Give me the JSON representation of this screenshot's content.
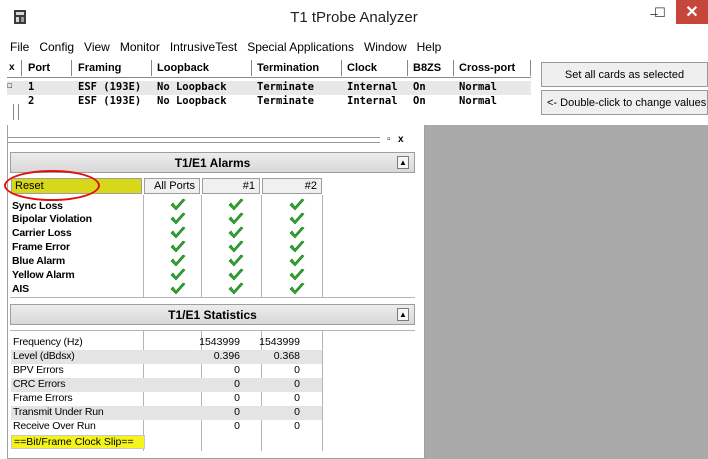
{
  "window": {
    "title": "T1 tProbe Analyzer",
    "icon": "app-icon",
    "controls": {
      "minimize": "–",
      "maximize": "☐",
      "close": "✕"
    }
  },
  "menu": [
    "File",
    "Config",
    "View",
    "Monitor",
    "IntrusiveTest",
    "Special Applications",
    "Window",
    "Help"
  ],
  "port_table": {
    "close_glyph": "x",
    "columns": [
      "Port",
      "Framing",
      "Loopback",
      "Termination",
      "Clock",
      "B8ZS",
      "Cross-port"
    ],
    "rows": [
      {
        "port": "1",
        "framing": "ESF (193E)",
        "loopback": "No Loopback",
        "termination": "Terminate",
        "clock": "Internal",
        "b8zs": "On",
        "cross_port": "Normal"
      },
      {
        "port": "2",
        "framing": "ESF (193E)",
        "loopback": "No Loopback",
        "termination": "Terminate",
        "clock": "Internal",
        "b8zs": "On",
        "cross_port": "Normal"
      }
    ]
  },
  "buttons": {
    "set_all": "Set all cards as selected",
    "change_values": "<- Double-click to change values"
  },
  "alarms": {
    "title": "T1/E1 Alarms",
    "reset_label": "Reset",
    "columns": [
      "All Ports",
      "#1",
      "#2"
    ],
    "rows": [
      {
        "label": "Sync Loss"
      },
      {
        "label": "Bipolar Violation"
      },
      {
        "label": "Carrier Loss"
      },
      {
        "label": "Frame Error"
      },
      {
        "label": "Blue Alarm"
      },
      {
        "label": "Yellow Alarm"
      },
      {
        "label": "AIS"
      }
    ],
    "status_icon": "green-check-icon"
  },
  "statistics": {
    "title": "T1/E1 Statistics",
    "rows": [
      {
        "label": "Frequency (Hz)",
        "p1": "1543999",
        "p2": "1543999"
      },
      {
        "label": "Level (dBdsx)",
        "p1": "0.396",
        "p2": "0.368"
      },
      {
        "label": "BPV Errors",
        "p1": "0",
        "p2": "0"
      },
      {
        "label": "CRC Errors",
        "p1": "0",
        "p2": "0"
      },
      {
        "label": "Frame Errors",
        "p1": "0",
        "p2": "0"
      },
      {
        "label": "Transmit Under Run",
        "p1": "0",
        "p2": "0"
      },
      {
        "label": "Receive Over Run",
        "p1": "0",
        "p2": "0"
      }
    ],
    "slip_label": "==Bit/Frame Clock Slip=="
  },
  "colors": {
    "reset_highlight": "#d8d81a",
    "slip_highlight": "#f4f41a",
    "close_button": "#c7463c",
    "check_green": "#2ea82e",
    "annotation_red": "#e01010"
  }
}
